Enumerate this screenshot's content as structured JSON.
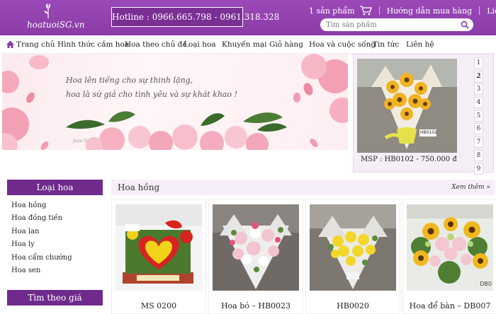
{
  "header": {
    "logo_text": "hoatuoiSG.vn",
    "hotline": "Hotline : 0966.665.798 - 0961.318.328",
    "cart_text": "1 sản phẩm",
    "guide_link": "Hướng dẫn mua hàng",
    "contact_link": "Liên hệ",
    "search_placeholder": "Tìm sản phẩm"
  },
  "nav": {
    "items": [
      "Trang chủ",
      "Hình thức cắm hoa",
      "Hoa theo chủ đề",
      "Loại hoa",
      "Khuyến mại",
      "Giỏ hàng",
      "Hoa và cuộc sống",
      "Tin tức",
      "Liên hệ"
    ]
  },
  "banner": {
    "line1": "Hoa lên tiếng cho sự thinh lặng,",
    "line2": "hoa là sứ giả cho tình yêu và sự khát khao !",
    "signature": "Jane D"
  },
  "slider": {
    "caption": "MSP : HB0102 - 750.000 đ",
    "image_tag": "HB0102",
    "numbers": [
      "1",
      "2",
      "3",
      "4",
      "5",
      "6",
      "7",
      "8",
      "9"
    ],
    "active": "2"
  },
  "sidebar": {
    "flower_types_title": "Loại hoa",
    "flower_types": [
      "Hoa hồng",
      "Hoa đồng tiền",
      "Hoa lan",
      "Hoa ly",
      "Hoa cẩm chướng",
      "Hoa sen"
    ],
    "price_title": "Tìm theo giá"
  },
  "section": {
    "title": "Hoa hồng",
    "see_more": "Xem thêm »",
    "products": [
      {
        "name": "MS 0200"
      },
      {
        "name": "Hoa bó – HB0023"
      },
      {
        "name": "HB0020"
      },
      {
        "name": "Hoa để bàn – DB007",
        "tag": "DB0"
      }
    ]
  },
  "colors": {
    "header_purple": "#8a3ca6",
    "sidebar_title": "#6f2a8c",
    "section_bg": "#f6eef8"
  }
}
